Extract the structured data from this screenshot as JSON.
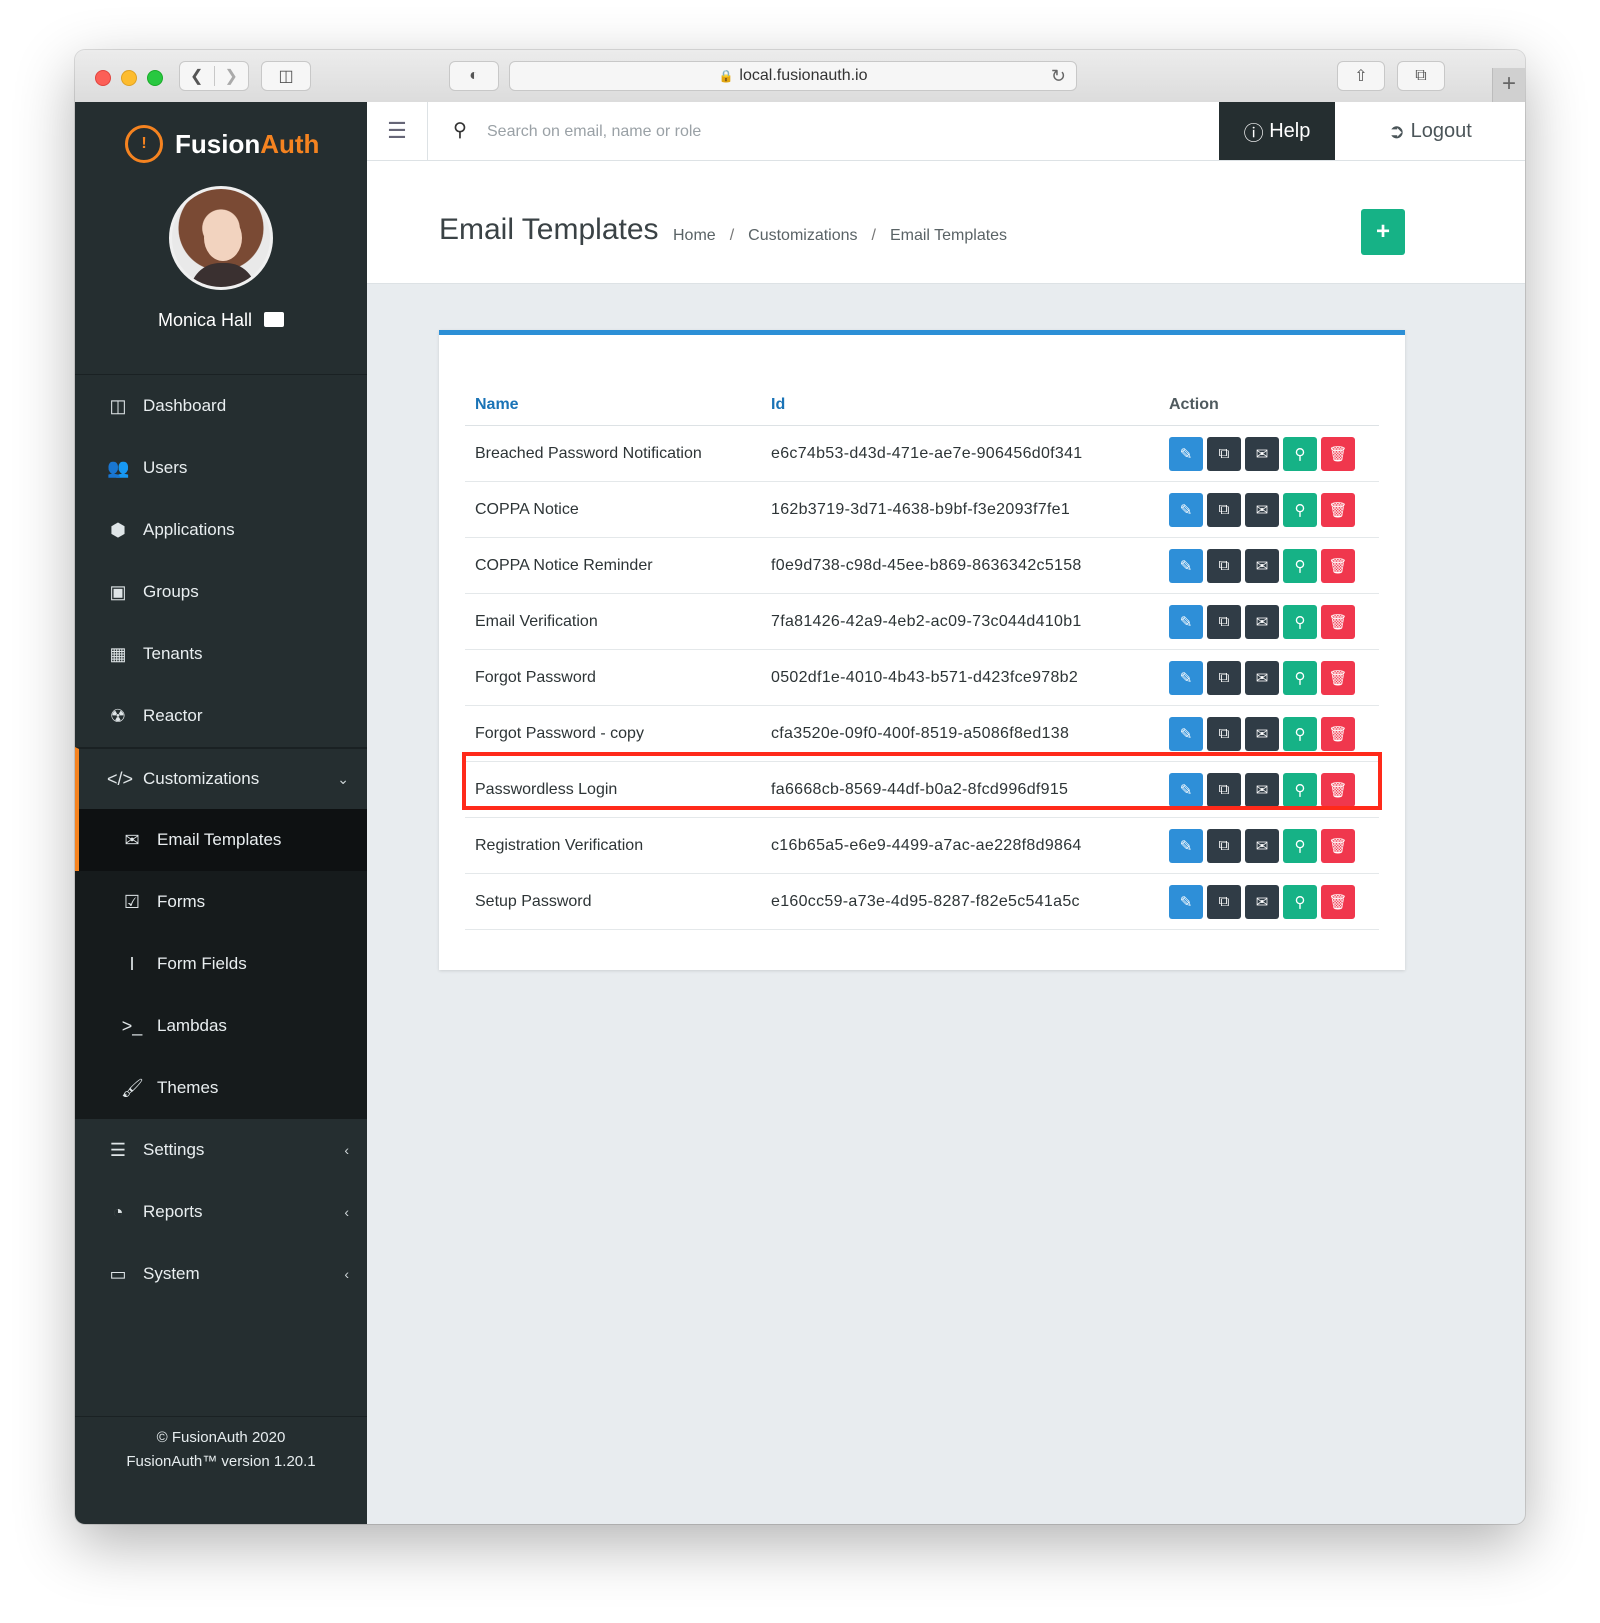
{
  "browser": {
    "url": "local.fusionauth.io"
  },
  "brand": {
    "name_part1": "Fusion",
    "name_part2": "Auth"
  },
  "user": {
    "name": "Monica Hall"
  },
  "sidebar": {
    "items": [
      {
        "label": "Dashboard",
        "icon": "dashboard-icon"
      },
      {
        "label": "Users",
        "icon": "users-icon"
      },
      {
        "label": "Applications",
        "icon": "cube-icon"
      },
      {
        "label": "Groups",
        "icon": "groups-icon"
      },
      {
        "label": "Tenants",
        "icon": "building-icon"
      },
      {
        "label": "Reactor",
        "icon": "reactor-icon"
      }
    ],
    "customizations": {
      "label": "Customizations",
      "children": [
        {
          "label": "Email Templates",
          "icon": "envelope-icon"
        },
        {
          "label": "Forms",
          "icon": "check-square-icon"
        },
        {
          "label": "Form Fields",
          "icon": "text-cursor-icon"
        },
        {
          "label": "Lambdas",
          "icon": "terminal-icon"
        },
        {
          "label": "Themes",
          "icon": "brush-icon"
        }
      ]
    },
    "bottom_items": [
      {
        "label": "Settings",
        "icon": "sliders-icon"
      },
      {
        "label": "Reports",
        "icon": "pie-chart-icon"
      },
      {
        "label": "System",
        "icon": "monitor-icon"
      }
    ],
    "footer_line1": "© FusionAuth 2020",
    "footer_line2": "FusionAuth™ version 1.20.1"
  },
  "topbar": {
    "search_placeholder": "Search on email, name or role",
    "help_label": "Help",
    "logout_label": "Logout"
  },
  "page": {
    "title": "Email Templates",
    "breadcrumb": [
      "Home",
      "Customizations",
      "Email Templates"
    ]
  },
  "table": {
    "headers": {
      "name": "Name",
      "id": "Id",
      "action": "Action"
    },
    "rows": [
      {
        "name": "Breached Password Notification",
        "id": "e6c74b53-d43d-471e-ae7e-906456d0f341"
      },
      {
        "name": "COPPA Notice",
        "id": "162b3719-3d71-4638-b9bf-f3e2093f7fe1"
      },
      {
        "name": "COPPA Notice Reminder",
        "id": "f0e9d738-c98d-45ee-b869-8636342c5158"
      },
      {
        "name": "Email Verification",
        "id": "7fa81426-42a9-4eb2-ac09-73c044d410b1"
      },
      {
        "name": "Forgot Password",
        "id": "0502df1e-4010-4b43-b571-d423fce978b2"
      },
      {
        "name": "Forgot Password - copy",
        "id": "cfa3520e-09f0-400f-8519-a5086f8ed138"
      },
      {
        "name": "Passwordless Login",
        "id": "fa6668cb-8569-44df-b0a2-8fcd996df915"
      },
      {
        "name": "Registration Verification",
        "id": "c16b65a5-e6e9-4499-a7ac-ae228f8d9864"
      },
      {
        "name": "Setup Password",
        "id": "e160cc59-a73e-4d95-8287-f82e5c541a5c"
      }
    ]
  },
  "colors": {
    "accent_orange": "#f58320",
    "panel_blue": "#2c8fd6",
    "green": "#16b286",
    "red": "#f0374d",
    "highlight": "#ff2a1a"
  }
}
